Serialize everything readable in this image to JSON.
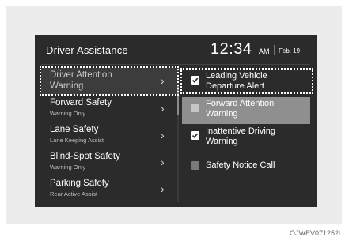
{
  "header": {
    "title": "Driver Assistance",
    "time": "12:34",
    "ampm": "AM",
    "date": "Feb. 19"
  },
  "menu": [
    {
      "title": "Driver Attention",
      "subtitle": "Warning"
    },
    {
      "title": "Forward Safety",
      "subtitle": "Warning Only"
    },
    {
      "title": "Lane Safety",
      "subtitle": "Lane Keeping Assist"
    },
    {
      "title": "Blind-Spot Safety",
      "subtitle": "Warning Only"
    },
    {
      "title": "Parking Safety",
      "subtitle": "Rear Active Assist"
    }
  ],
  "options": [
    {
      "line1": "Leading Vehicle",
      "line2": "Departure Alert",
      "checked": true
    },
    {
      "line1": "Forward Attention",
      "line2": "Warning",
      "checked": false
    },
    {
      "line1": "Inattentive Driving",
      "line2": "Warning",
      "checked": true
    },
    {
      "line1": "Safety Notice Call",
      "line2": "",
      "checked": false
    }
  ],
  "caption": "OJWEV071252L"
}
